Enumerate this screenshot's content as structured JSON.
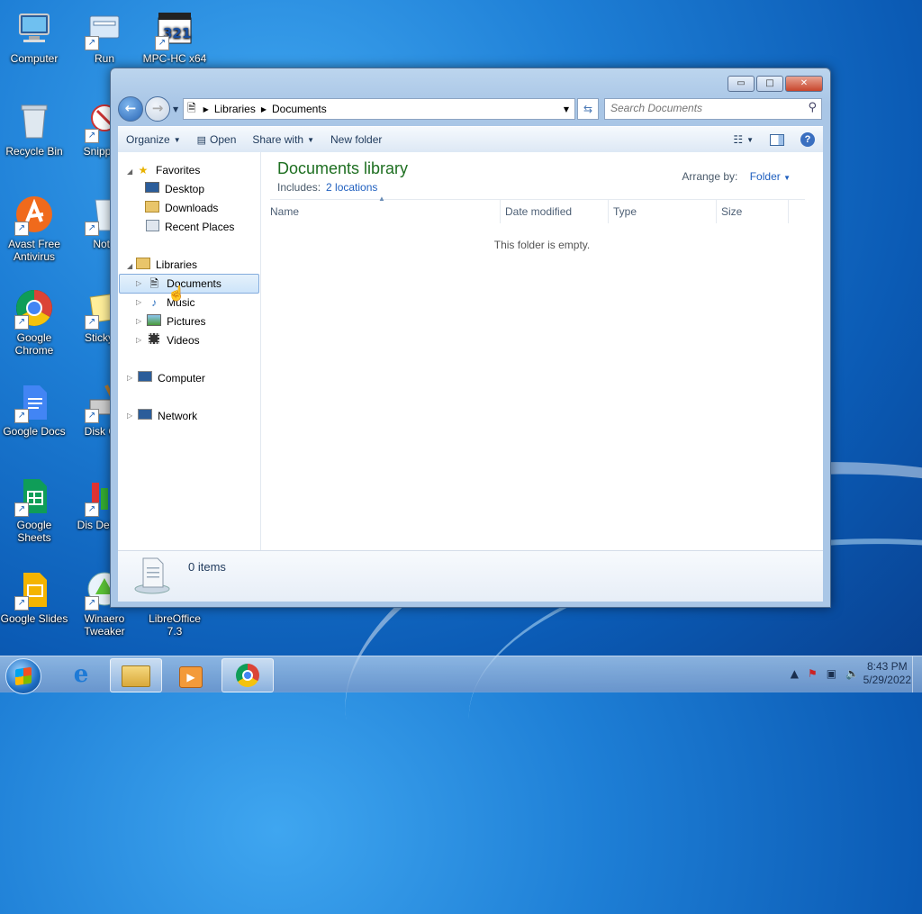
{
  "desktop": {
    "icons": [
      {
        "label": "Computer",
        "icon": "computer-icon"
      },
      {
        "label": "Run",
        "icon": "run-icon"
      },
      {
        "label": "MPC-HC x64",
        "icon": "mpc-hc-icon"
      },
      {
        "label": "Recycle Bin",
        "icon": "recycle-bin-icon"
      },
      {
        "label": "Snipping",
        "icon": "snipping-tool-icon"
      },
      {
        "label": "Avast Free Antivirus",
        "icon": "avast-icon"
      },
      {
        "label": "Note",
        "icon": "notepad-icon"
      },
      {
        "label": "Google Chrome",
        "icon": "chrome-icon"
      },
      {
        "label": "Sticky N",
        "icon": "sticky-notes-icon"
      },
      {
        "label": "Google Docs",
        "icon": "google-docs-icon"
      },
      {
        "label": "Disk Cle",
        "icon": "disk-cleanup-icon"
      },
      {
        "label": "Google Sheets",
        "icon": "google-sheets-icon"
      },
      {
        "label": "Dis Defragr",
        "icon": "defragment-icon"
      },
      {
        "label": "Google Slides",
        "icon": "google-slides-icon"
      },
      {
        "label": "Winaero Tweaker",
        "icon": "winaero-icon"
      },
      {
        "label": "LibreOffice 7.3",
        "icon": "libreoffice-icon"
      }
    ]
  },
  "window": {
    "caption_buttons": {
      "minimize": "▭",
      "maximize": "□",
      "close": "✕"
    },
    "address": {
      "crumbs": [
        "Libraries",
        "Documents"
      ]
    },
    "search": {
      "placeholder": "Search Documents"
    },
    "toolbar": {
      "organize": "Organize",
      "open": "Open",
      "share_with": "Share with",
      "new_folder": "New folder"
    },
    "nav": {
      "favorites": "Favorites",
      "desktop": "Desktop",
      "downloads": "Downloads",
      "recent_places": "Recent Places",
      "libraries": "Libraries",
      "documents": "Documents",
      "music": "Music",
      "pictures": "Pictures",
      "videos": "Videos",
      "computer": "Computer",
      "network": "Network"
    },
    "library": {
      "title": "Documents library",
      "includes_label": "Includes:",
      "includes_link": "2 locations",
      "arrange_label": "Arrange by:",
      "arrange_value": "Folder"
    },
    "columns": [
      "Name",
      "Date modified",
      "Type",
      "Size"
    ],
    "empty_message": "This folder is empty.",
    "details": {
      "count": "0 items"
    }
  },
  "taskbar": {
    "clock": {
      "time": "8:43 PM",
      "date": "5/29/2022"
    },
    "colors": {
      "accent": "#1e6fc4",
      "library_title": "#1e6f21",
      "link": "#1f5fbf"
    }
  }
}
